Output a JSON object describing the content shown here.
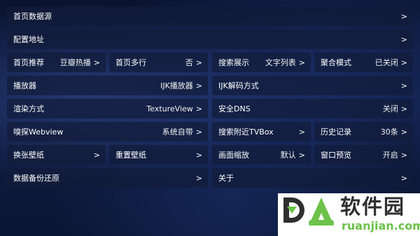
{
  "settings": {
    "home_source": {
      "label": "首页数据源",
      "value": ""
    },
    "config_url": {
      "label": "配置地址",
      "value": ""
    },
    "home_recommend": {
      "label": "首页推荐",
      "value": "豆瓣热播"
    },
    "home_multiline": {
      "label": "首页多行",
      "value": "否"
    },
    "search_display": {
      "label": "搜索展示",
      "value": "文字列表"
    },
    "aggregate_mode": {
      "label": "聚合模式",
      "value": "已关闭"
    },
    "player": {
      "label": "播放器",
      "value": "IJK播放器"
    },
    "ijk_decode": {
      "label": "IJK解码方式",
      "value": ""
    },
    "render_mode": {
      "label": "渲染方式",
      "value": "TextureView"
    },
    "secure_dns": {
      "label": "安全DNS",
      "value": "关闭"
    },
    "sniff_webview": {
      "label": "嗅探Webview",
      "value": "系统自带"
    },
    "search_nearby_tvbox": {
      "label": "搜索附近TVBox",
      "value": ""
    },
    "history": {
      "label": "历史记录",
      "value": "30条"
    },
    "change_wallpaper": {
      "label": "换张壁纸",
      "value": ""
    },
    "reset_wallpaper": {
      "label": "重置壁纸",
      "value": ""
    },
    "screen_scale": {
      "label": "画面缩放",
      "value": "默认"
    },
    "window_preview": {
      "label": "窗口预览",
      "value": "开启"
    },
    "backup_restore": {
      "label": "数据备份还原",
      "value": ""
    },
    "about": {
      "label": "关于",
      "value": ""
    }
  },
  "arrow_glyph": ">",
  "watermark": {
    "brand": "软件园",
    "url": "ruanjian.com",
    "accent_color": "#6cc24a",
    "dark_color": "#2f2f2f"
  }
}
